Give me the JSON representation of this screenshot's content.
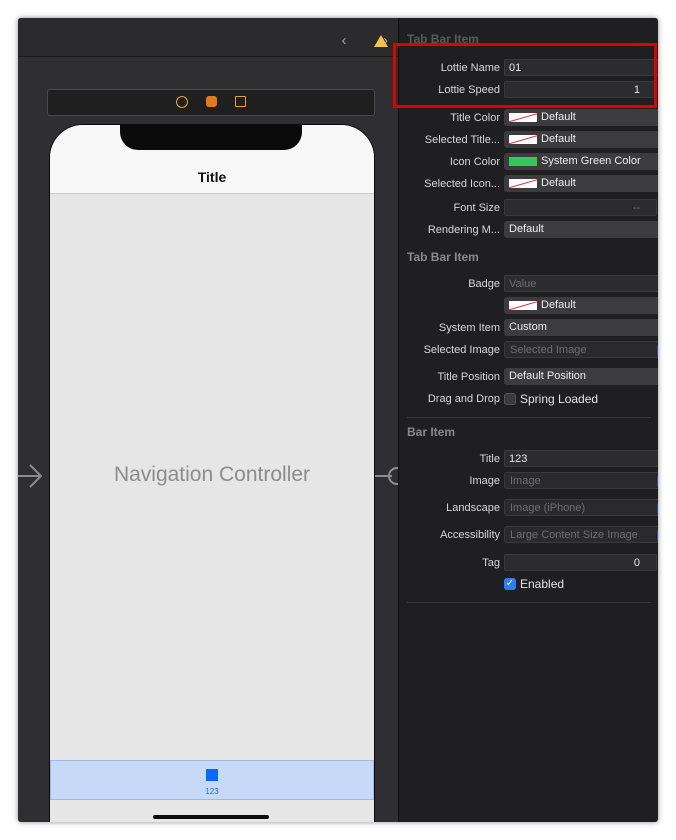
{
  "canvas": {
    "nav_title": "Title",
    "controller_label": "Navigation Controller",
    "tab_item_label": "123"
  },
  "inspector": {
    "custom_section_title": "Tab Bar Item",
    "lottie_name": {
      "label": "Lottie Name",
      "value": "01"
    },
    "lottie_speed": {
      "label": "Lottie Speed",
      "value": "1"
    },
    "title_color": {
      "label": "Title Color",
      "value": "Default"
    },
    "selected_title_color": {
      "label": "Selected Title...",
      "value": "Default"
    },
    "icon_color": {
      "label": "Icon Color",
      "value": "System Green Color"
    },
    "selected_icon_color": {
      "label": "Selected Icon...",
      "value": "Default"
    },
    "font_size": {
      "label": "Font Size",
      "value": "--"
    },
    "rendering_mode": {
      "label": "Rendering M...",
      "value": "Default"
    },
    "tab_section_title": "Tab Bar Item",
    "badge": {
      "label": "Badge",
      "placeholder": "Value"
    },
    "badge_color": {
      "value": "Default"
    },
    "system_item": {
      "label": "System Item",
      "value": "Custom"
    },
    "selected_image": {
      "label": "Selected Image",
      "placeholder": "Selected Image"
    },
    "title_position": {
      "label": "Title Position",
      "value": "Default Position"
    },
    "drag_and_drop": {
      "label": "Drag and Drop",
      "checkbox_label": "Spring Loaded",
      "checked": false
    },
    "bar_section_title": "Bar Item",
    "title": {
      "label": "Title",
      "value": "123"
    },
    "image": {
      "label": "Image",
      "placeholder": "Image"
    },
    "landscape": {
      "label": "Landscape",
      "placeholder": "Image (iPhone)"
    },
    "accessibility": {
      "label": "Accessibility",
      "placeholder": "Large Content Size Image"
    },
    "tag": {
      "label": "Tag",
      "value": "0"
    },
    "enabled": {
      "label": "Enabled",
      "checked": true
    }
  },
  "colors": {
    "highlight": "#e00000",
    "accent": "#2d63d8",
    "tab_selected": "#0a69f5",
    "warning": "#f6c344",
    "system_green": "#34c759"
  }
}
